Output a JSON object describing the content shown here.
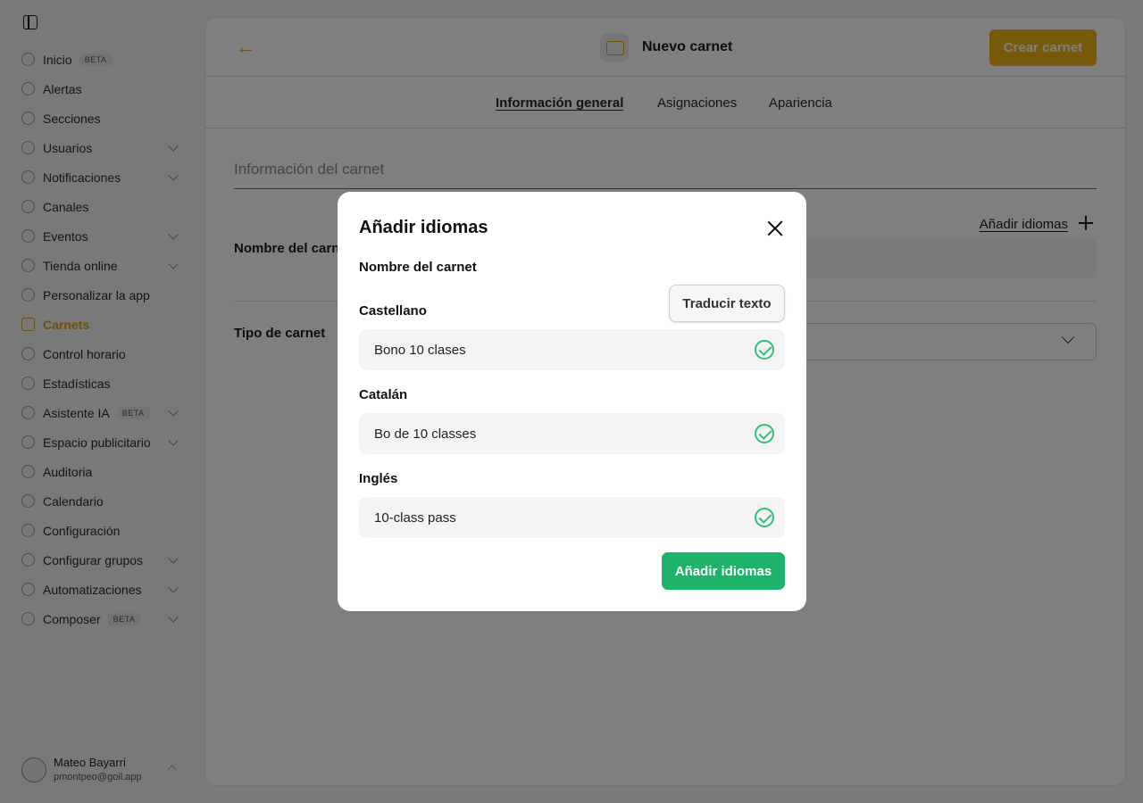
{
  "sidebar": {
    "items": [
      {
        "label": "Inicio",
        "badge": "BETA",
        "expandable": false
      },
      {
        "label": "Alertas",
        "badge": "",
        "expandable": false
      },
      {
        "label": "Secciones",
        "badge": "",
        "expandable": false
      },
      {
        "label": "Usuarios",
        "badge": "",
        "expandable": true
      },
      {
        "label": "Notificaciones",
        "badge": "",
        "expandable": true
      },
      {
        "label": "Canales",
        "badge": "",
        "expandable": false
      },
      {
        "label": "Eventos",
        "badge": "",
        "expandable": true
      },
      {
        "label": "Tienda online",
        "badge": "",
        "expandable": true
      },
      {
        "label": "Personalizar la app",
        "badge": "",
        "expandable": false
      },
      {
        "label": "Carnets",
        "badge": "",
        "expandable": false,
        "active": true
      },
      {
        "label": "Control horario",
        "badge": "",
        "expandable": false
      },
      {
        "label": "Estadísticas",
        "badge": "",
        "expandable": false
      },
      {
        "label": "Asistente IA",
        "badge": "BETA",
        "expandable": true
      },
      {
        "label": "Espacio publicitario",
        "badge": "",
        "expandable": true
      },
      {
        "label": "Auditoria",
        "badge": "",
        "expandable": false
      },
      {
        "label": "Calendario",
        "badge": "",
        "expandable": false
      },
      {
        "label": "Configuración",
        "badge": "",
        "expandable": false
      },
      {
        "label": "Configurar grupos",
        "badge": "",
        "expandable": true
      },
      {
        "label": "Automatizaciones",
        "badge": "",
        "expandable": true
      },
      {
        "label": "Composer",
        "badge": "BETA",
        "expandable": true
      }
    ],
    "user": {
      "name": "Mateo Bayarri",
      "email": "pmontpeo@goil.app"
    }
  },
  "header": {
    "title": "Nuevo carnet",
    "create_label": "Crear carnet"
  },
  "tabs": [
    {
      "label": "Información general",
      "active": true
    },
    {
      "label": "Asignaciones",
      "active": false
    },
    {
      "label": "Apariencia",
      "active": false
    }
  ],
  "form": {
    "section_title": "Información del carnet",
    "add_languages_link": "Añadir idiomas",
    "name_label": "Nombre del carnet",
    "type_label": "Tipo de carnet"
  },
  "modal": {
    "title": "Añadir idiomas",
    "subtitle": "Nombre del carnet",
    "translate_label": "Traducir texto",
    "languages": [
      {
        "label": "Castellano",
        "value": "Bono 10 clases"
      },
      {
        "label": "Catalán",
        "value": "Bo de 10 classes"
      },
      {
        "label": "Inglés",
        "value": "10-class pass"
      }
    ],
    "submit_label": "Añadir idiomas"
  },
  "colors": {
    "accent": "#f1b317",
    "success": "#1db36a",
    "check": "#2fbf78"
  }
}
